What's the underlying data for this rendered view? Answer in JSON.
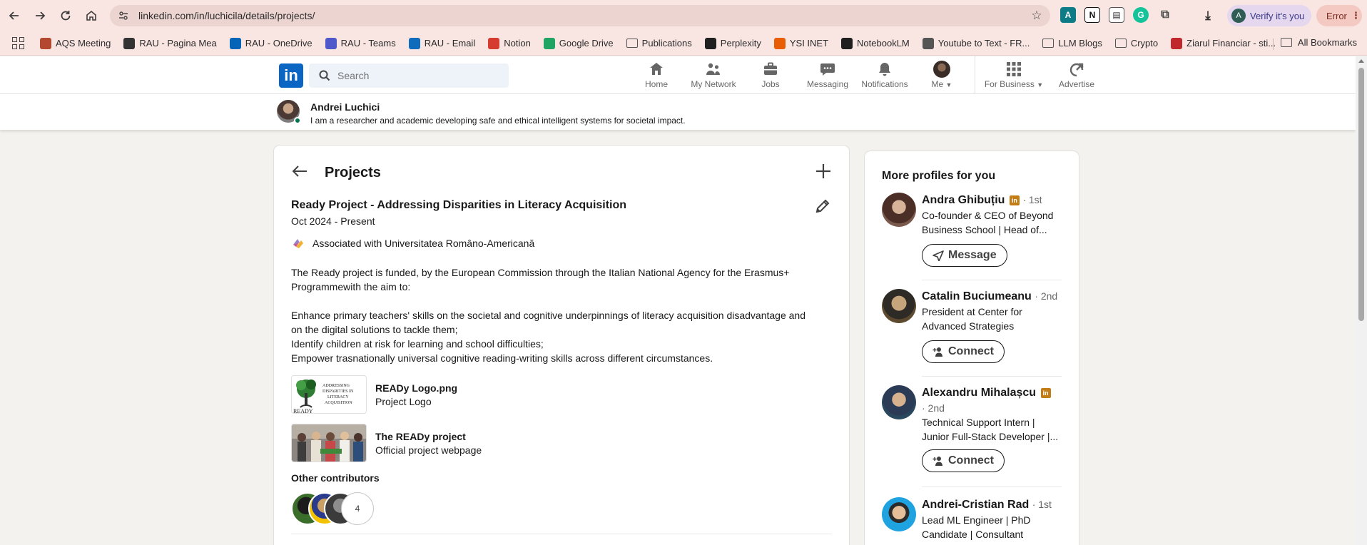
{
  "browser": {
    "url": "linkedin.com/in/luchicila/details/projects/",
    "verify_label": "Verify it's you",
    "error_label": "Error",
    "bookmarks": [
      {
        "label": "AQS Meeting",
        "color": "#b4472f"
      },
      {
        "label": "RAU - Pagina Mea",
        "color": "#333333"
      },
      {
        "label": "RAU - OneDrive",
        "color": "#0364b8"
      },
      {
        "label": "RAU - Teams",
        "color": "#5059c9"
      },
      {
        "label": "RAU - Email",
        "color": "#0f6cbd"
      },
      {
        "label": "Notion",
        "color": "#d63b2f"
      },
      {
        "label": "Google Drive",
        "color": "#1fa463"
      },
      {
        "label": "Publications",
        "color": "folder"
      },
      {
        "label": "Perplexity",
        "color": "#1f1f1f"
      },
      {
        "label": "YSI INET",
        "color": "#e85d04"
      },
      {
        "label": "NotebookLM",
        "color": "#1f1f1f"
      },
      {
        "label": "Youtube to Text - FR...",
        "color": "#555555"
      },
      {
        "label": "LLM Blogs",
        "color": "folder"
      },
      {
        "label": "Crypto",
        "color": "folder"
      },
      {
        "label": "Ziarul Financiar - sti...",
        "color": "#c0282d"
      }
    ],
    "all_bookmarks_label": "All Bookmarks"
  },
  "linkedin": {
    "logo_text": "in",
    "search_placeholder": "Search",
    "nav": [
      {
        "label": "Home",
        "icon": "home-icon"
      },
      {
        "label": "My Network",
        "icon": "people-icon"
      },
      {
        "label": "Jobs",
        "icon": "briefcase-icon"
      },
      {
        "label": "Messaging",
        "icon": "chat-icon"
      },
      {
        "label": "Notifications",
        "icon": "bell-icon"
      },
      {
        "label": "Me",
        "icon": "avatar"
      },
      {
        "label": "For Business",
        "icon": "grid-icon"
      },
      {
        "label": "Advertise",
        "icon": "advertise-icon"
      }
    ],
    "accent": "#0a66c2"
  },
  "profile": {
    "name": "Andrei Luchici",
    "headline": "I am a researcher and academic developing safe and ethical intelligent systems for societal impact."
  },
  "projects": {
    "title": "Projects",
    "item": {
      "title": "Ready Project - Addressing Disparities in Literacy Acquisition",
      "date": "Oct 2024 - Present",
      "associated": "Associated with Universitatea Româno-Americană",
      "description_intro": "The Ready project is funded, by the European Commission through the Italian National Agency for the Erasmus+ Programmewith the aim to:",
      "description_lines": [
        "Enhance primary teachers' skills on the societal and cognitive underpinnings of literacy acquisition disadvantage and on the digital solutions to tackle them;",
        "Identify children at risk for learning and school difficulties;",
        "Empower trasnationally universal cognitive reading-writing skills across different circumstances."
      ],
      "media": [
        {
          "title": "READy Logo.png",
          "subtitle": "Project Logo"
        },
        {
          "title": "The READy project",
          "subtitle": "Official project webpage"
        }
      ],
      "logo_thumb_text": [
        "ADDRESSING",
        "DISPARITIES IN",
        "LITERACY",
        "ACQUISITION",
        "READY"
      ],
      "contributors_label": "Other contributors",
      "contributors_more": "4"
    }
  },
  "side": {
    "title": "More profiles for you",
    "people": [
      {
        "name": "Andra Ghibuțiu",
        "degree": "· 1st",
        "desc": "Co-founder & CEO of Beyond Business School | Head of...",
        "button": "Message",
        "badge": true
      },
      {
        "name": "Catalin Buciumeanu",
        "degree": "· 2nd",
        "desc": "President at Center for Advanced Strategies",
        "button": "Connect",
        "badge": false
      },
      {
        "name": "Alexandru Mihalașcu",
        "degree": "· 2nd",
        "desc": "Technical Support Intern | Junior Full-Stack Developer |...",
        "button": "Connect",
        "badge": true
      },
      {
        "name": "Andrei-Cristian Rad",
        "degree": "· 1st",
        "desc": "Lead ML Engineer | PhD Candidate | Consultant",
        "button": "",
        "badge": false
      }
    ]
  }
}
